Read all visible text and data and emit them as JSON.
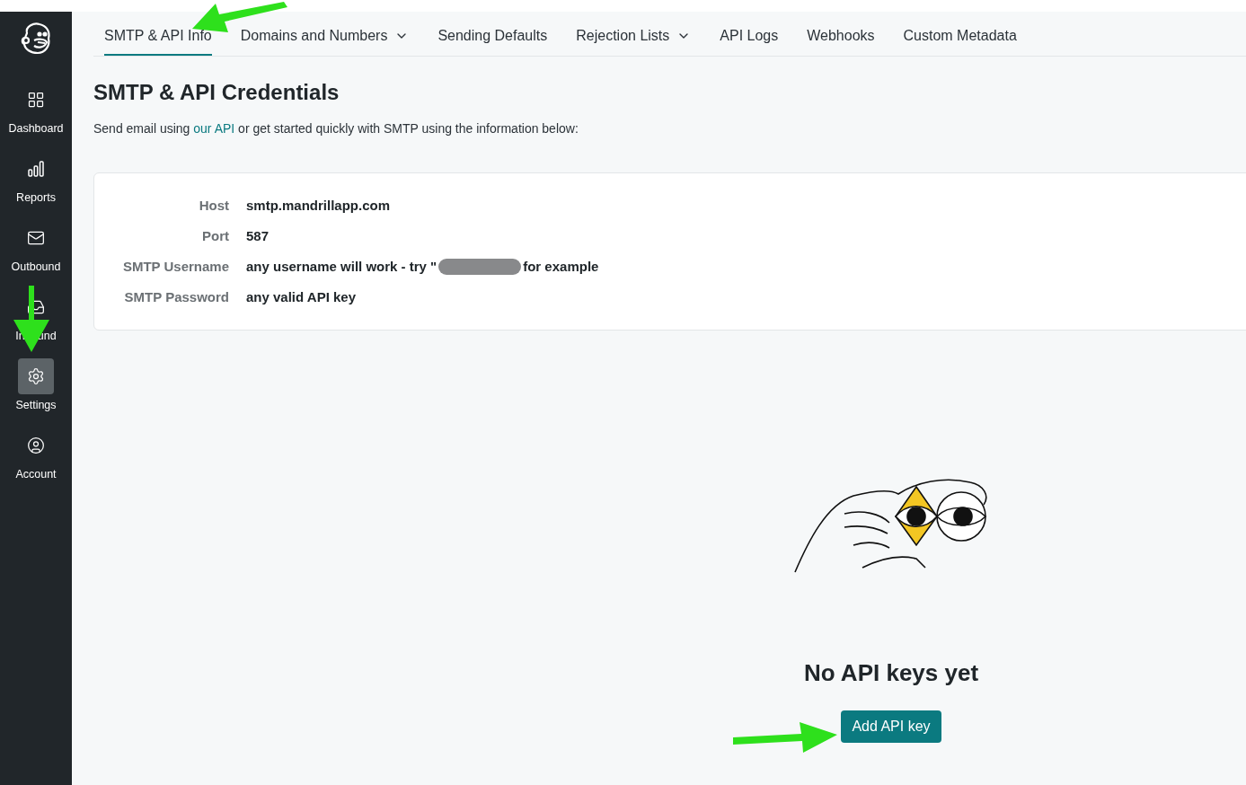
{
  "sidebar": {
    "items": [
      {
        "label": "Dashboard",
        "selected": false
      },
      {
        "label": "Reports",
        "selected": false
      },
      {
        "label": "Outbound",
        "selected": false
      },
      {
        "label": "In",
        "label_after": "und",
        "selected": false
      },
      {
        "label": "Settings",
        "selected": true
      },
      {
        "label": "Account",
        "selected": false
      }
    ]
  },
  "tabs": [
    {
      "label": "SMTP & API Info",
      "selected": true,
      "dropdown": false
    },
    {
      "label": "Domains and Numbers",
      "selected": false,
      "dropdown": true
    },
    {
      "label": "Sending Defaults",
      "selected": false,
      "dropdown": false
    },
    {
      "label": "Rejection Lists",
      "selected": false,
      "dropdown": true
    },
    {
      "label": "API Logs",
      "selected": false,
      "dropdown": false
    },
    {
      "label": "Webhooks",
      "selected": false,
      "dropdown": false
    },
    {
      "label": "Custom Metadata",
      "selected": false,
      "dropdown": false
    }
  ],
  "heading": "SMTP & API Credentials",
  "description": {
    "before": "Send email using ",
    "link": "our API",
    "after": " or get started quickly with SMTP using the information below:"
  },
  "credentials": [
    {
      "label": "Host",
      "value": "smtp.mandrillapp.com",
      "redacted": false
    },
    {
      "label": "Port",
      "value": "587",
      "redacted": false
    },
    {
      "label": "SMTP Username",
      "value": "any username will work - try \"",
      "redacted": true,
      "value_after": "for example"
    },
    {
      "label": "SMTP Password",
      "value": "any valid API key",
      "redacted": false
    }
  ],
  "empty_state": {
    "title": "No API keys yet",
    "button": "Add API key"
  }
}
